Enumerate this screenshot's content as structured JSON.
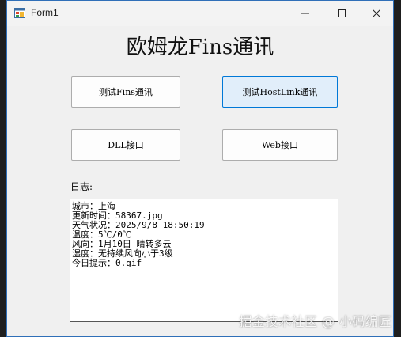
{
  "window": {
    "title": "Form1"
  },
  "heading": "欧姆龙Fins通讯",
  "buttons": {
    "fins": "测试Fins通讯",
    "hostlink": "测试HostLink通讯",
    "dll": "DLL接口",
    "web": "Web接口"
  },
  "log": {
    "label": "日志:",
    "lines": [
      "城市：上海",
      "更新时间：58367.jpg",
      "天气状况：2025/9/8 18:50:19",
      "温度：5℃/0℃",
      "风向：1月10日 晴转多云",
      "湿度：无持续风向小于3级",
      "今日提示：0.gif"
    ]
  },
  "watermark": "掘金技术社区 @ 小码编匠",
  "colors": {
    "focus_border": "#0078d7",
    "focus_fill": "#e1eefa",
    "window_bg": "#f0f0f0"
  }
}
